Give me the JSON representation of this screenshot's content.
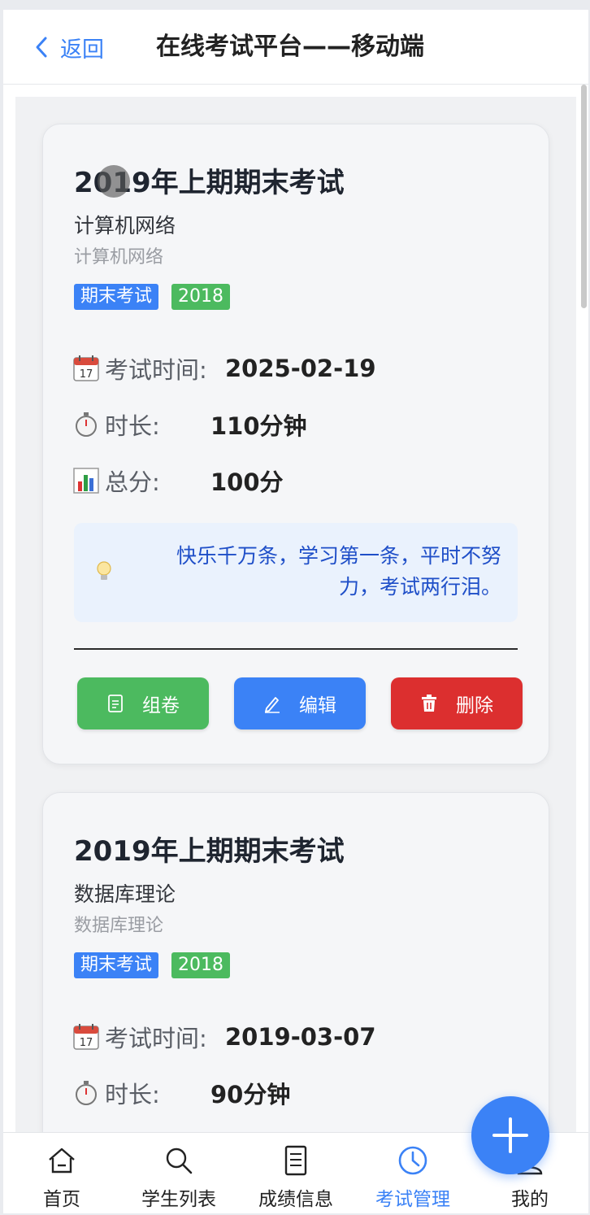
{
  "header": {
    "back_label": "返回",
    "title": "在线考试平台——移动端"
  },
  "exams": [
    {
      "title": "2019年上期期末考试",
      "course": "计算机网络",
      "course_sub": "计算机网络",
      "tags": [
        "期末考试",
        "2018"
      ],
      "time_label": "考试时间:",
      "time_value": "2025-02-19",
      "duration_label": "时长:",
      "duration_value": "110分钟",
      "score_label": "总分:",
      "score_value": "100分",
      "quote": "快乐千万条，学习第一条，平时不努力，考试两行泪。",
      "buttons": {
        "compose": "组卷",
        "edit": "编辑",
        "delete": "删除"
      }
    },
    {
      "title": "2019年上期期末考试",
      "course": "数据库理论",
      "course_sub": "数据库理论",
      "tags": [
        "期末考试",
        "2018"
      ],
      "time_label": "考试时间:",
      "time_value": "2019-03-07",
      "duration_label": "时长:",
      "duration_value": "90分钟"
    }
  ],
  "tabbar": {
    "items": [
      {
        "label": "首页",
        "icon": "home-icon"
      },
      {
        "label": "学生列表",
        "icon": "search-icon"
      },
      {
        "label": "成绩信息",
        "icon": "document-icon"
      },
      {
        "label": "考试管理",
        "icon": "clock-icon",
        "active": true
      },
      {
        "label": "我的",
        "icon": "user-icon"
      }
    ]
  },
  "colors": {
    "primary": "#3b82f6",
    "success": "#4cba5f",
    "danger": "#dc2f2f"
  }
}
